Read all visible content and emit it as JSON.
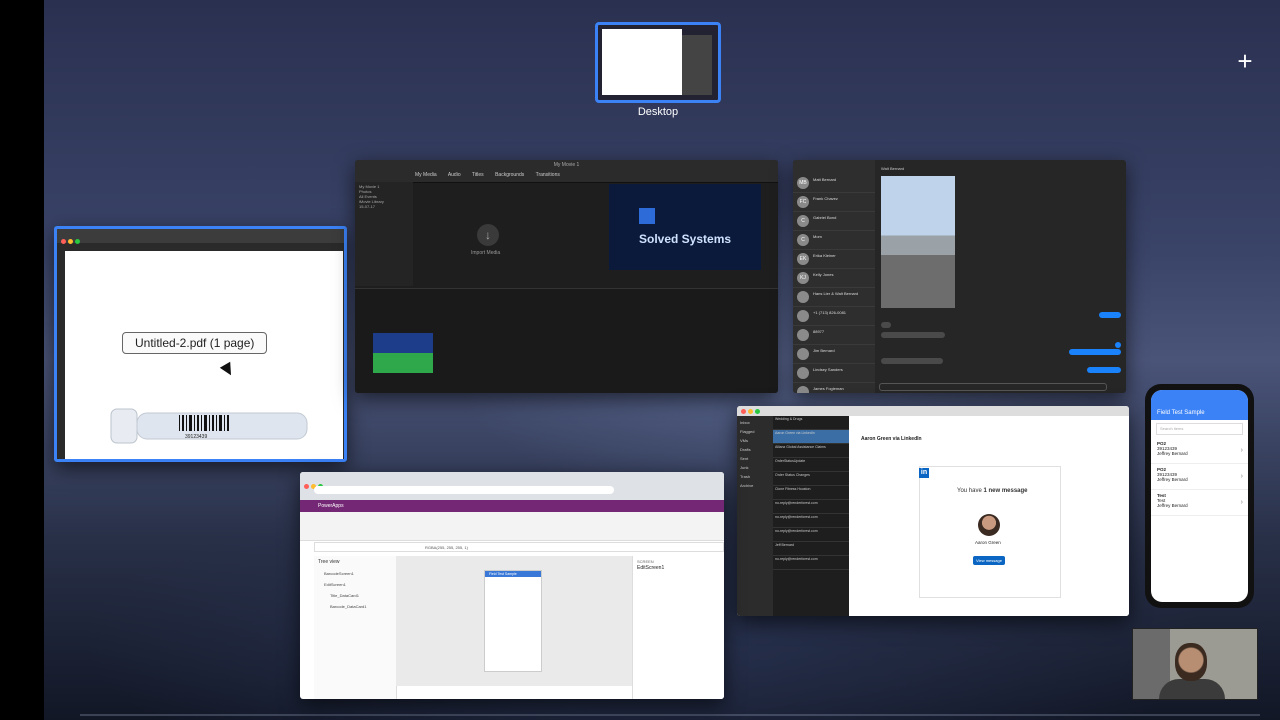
{
  "spaces": {
    "desktop_label": "Desktop",
    "add_label": "+"
  },
  "preview": {
    "title": "Untitled-2.pdf (1 page)",
    "tooltip": "Untitled-2.pdf (1 page)",
    "barcode_number": "39123439"
  },
  "imovie": {
    "title": "My Movie 1",
    "tabs": [
      "My Media",
      "Audio",
      "Titles",
      "Backgrounds",
      "Transitions"
    ],
    "sidebar_items": [
      "My Movie 1",
      "Photos",
      "All Events",
      "iMovie Library",
      "15-07-17"
    ],
    "import_label": "Import Media",
    "viewer_text": "Solved Systems"
  },
  "messages": {
    "conversation_with": "Walt Bernard",
    "contacts": [
      {
        "initials": "MB",
        "name": "Matt Bernard"
      },
      {
        "initials": "FC",
        "name": "Frank Chavez"
      },
      {
        "initials": "C",
        "name": "Gabriel Bond"
      },
      {
        "initials": "C",
        "name": "Mom"
      },
      {
        "initials": "EK",
        "name": "Erika Kleiner"
      },
      {
        "initials": "KJ",
        "name": "Kelly Jones"
      },
      {
        "initials": "",
        "name": "Hans Lier & Walt Bernard"
      },
      {
        "initials": "",
        "name": "+1 (713) 826-0081"
      },
      {
        "initials": "",
        "name": "88977"
      },
      {
        "initials": "",
        "name": "Jim Bernard"
      },
      {
        "initials": "",
        "name": "Lindsey Sanders"
      },
      {
        "initials": "",
        "name": "James Fogleman"
      }
    ]
  },
  "outlook": {
    "sender": "Aaron Green via LinkedIn",
    "headline_prefix": "You have ",
    "headline_bold": "1 new message",
    "profile_name": "Aaron Green",
    "button": "View message",
    "folders": [
      "Inbox",
      "Flagged",
      "VMs",
      "Drafts",
      "Sent",
      "Junk",
      "Trash",
      "Archive"
    ],
    "mail_rows": [
      "Wedding & Drugs",
      "Aaron Green via LinkedIn",
      "Allianz Global Assistance Claims",
      "OrderStatusUpdate",
      "Order Status Changes",
      "Clone Fitness Houston",
      "no-reply@renderforest.com",
      "no-reply@renderforest.com",
      "no-reply@renderforest.com",
      "Jeff Bernard",
      "no-reply@renderforest.com"
    ]
  },
  "powerapps": {
    "app_name": "PowerApps",
    "formula": "RGBA(255, 255, 255, 1)",
    "tree_title": "Tree view",
    "tree_items": [
      "BarcodeScreen1",
      "EditScreen1",
      "Title_DataCard1",
      "Barcode_DataCard1"
    ],
    "screen_title": "Field Test Sample",
    "props_title": "SCREEN",
    "props_name": "EditScreen1"
  },
  "phone": {
    "title": "Field Test Sample",
    "search_placeholder": "Search items",
    "items": [
      {
        "title": "PO2",
        "line1": "39123439",
        "line2": "Jeffrey Bernard"
      },
      {
        "title": "PO2",
        "line1": "39123439",
        "line2": "Jeffrey Bernard"
      },
      {
        "title": "Test",
        "line1": "Test",
        "line2": "Jeffrey Bernard"
      }
    ]
  }
}
